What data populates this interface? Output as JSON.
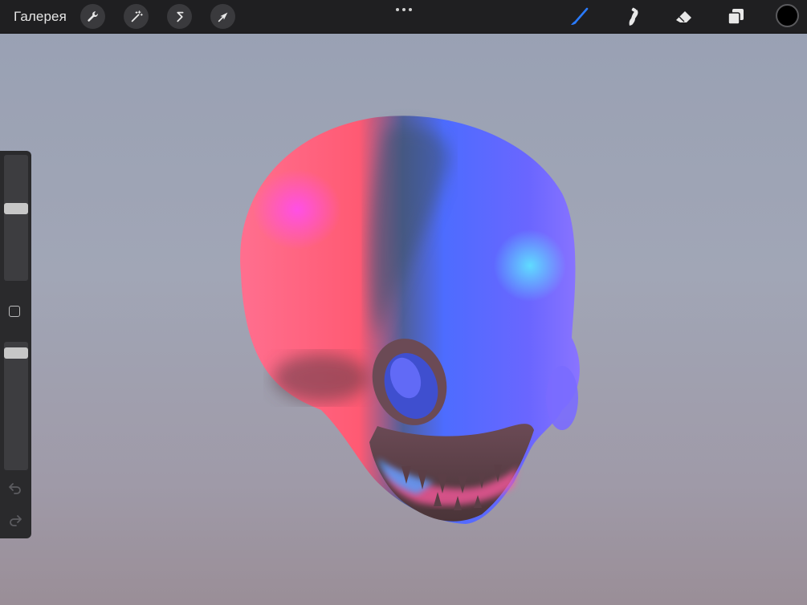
{
  "topbar": {
    "gallery_label": "Галерея",
    "left_tools": [
      {
        "icon": "wrench-icon",
        "name": "actions"
      },
      {
        "icon": "magic-wand-icon",
        "name": "adjustments"
      },
      {
        "icon": "selection-s-icon",
        "name": "selection"
      },
      {
        "icon": "arrow-cursor-icon",
        "name": "transform"
      }
    ],
    "more_icon": "ellipsis-icon",
    "right_tools": [
      {
        "icon": "brush-icon",
        "name": "paint",
        "active": true
      },
      {
        "icon": "smudge-icon",
        "name": "smudge"
      },
      {
        "icon": "eraser-icon",
        "name": "erase"
      },
      {
        "icon": "layers-icon",
        "name": "layers"
      }
    ],
    "current_color": "#000000"
  },
  "sidebar": {
    "brush_size_level": 0.58,
    "opacity_level": 0.95,
    "modify_icon": "square-icon",
    "undo_icon": "undo-icon",
    "redo_icon": "redo-icon"
  },
  "colors": {
    "accent_active": "#2a7bff",
    "toolbar_bg": "#1f1f21"
  }
}
